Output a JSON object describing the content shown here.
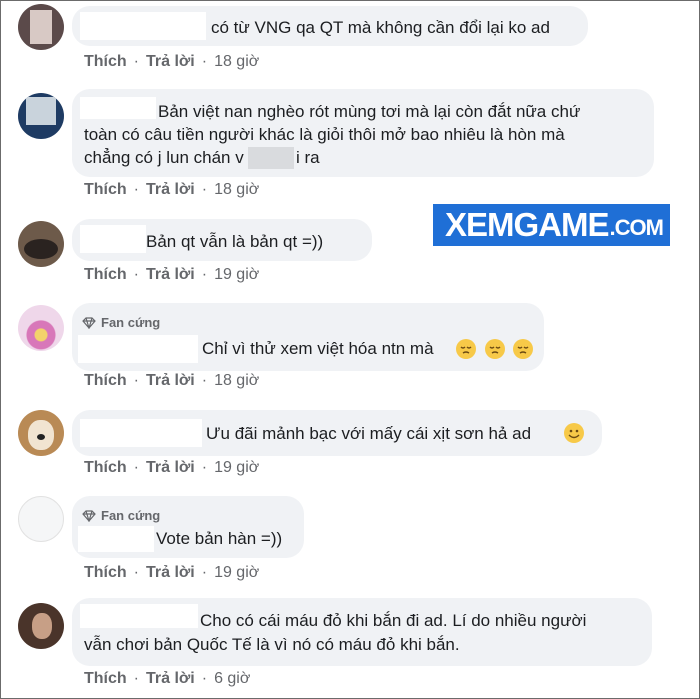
{
  "actions": {
    "like": "Thích",
    "reply": "Trả lời",
    "separator": "·"
  },
  "badge_label": "Fan cứng",
  "watermark": {
    "main": "XEMGAME",
    "suffix": ".COM"
  },
  "comments": [
    {
      "lines": [
        "có từ VNG qa QT mà không cần đổi lại ko ad"
      ],
      "time": "18 giờ"
    },
    {
      "lines": [
        "Bản việt nan nghèo rót mùng tơi mà lại còn đắt nữa chứ",
        "toàn có câu tiền người khác là giỏi thôi mở bao nhiêu là hòn mà",
        "chẳng có j lun chán v",
        "i ra"
      ],
      "time": "18 giờ"
    },
    {
      "lines": [
        "Bản qt vẫn là bản qt =))"
      ],
      "time": "19 giờ"
    },
    {
      "lines": [
        "Chỉ vì thử xem việt hóa ntn mà"
      ],
      "time": "18 giờ",
      "emoji": [
        "pensive-emoji",
        "pensive-emoji",
        "pensive-emoji"
      ]
    },
    {
      "lines": [
        "Ưu đãi mảnh bạc với mấy cái xịt sơn hả ad"
      ],
      "time": "19 giờ",
      "emoji": [
        "smile-emoji"
      ]
    },
    {
      "lines": [
        "Vote bản hàn =))"
      ],
      "time": "19 giờ"
    },
    {
      "lines": [
        "Cho có cái máu đỏ khi bắn đi ad. Lí do nhiều người",
        "vẫn chơi bản Quốc Tế là vì nó có máu đỏ khi bắn."
      ],
      "time": "6 giờ"
    }
  ]
}
